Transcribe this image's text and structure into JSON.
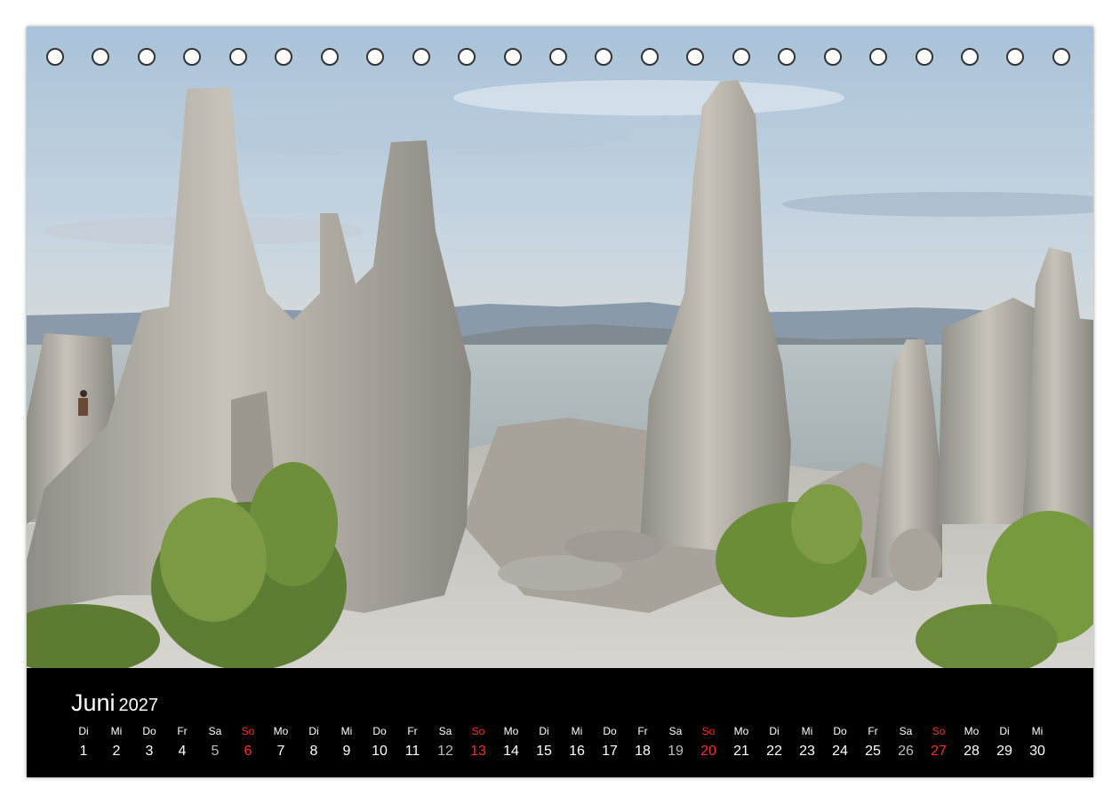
{
  "calendar": {
    "month": "Juni",
    "year": "2027",
    "days": [
      {
        "wd": "Di",
        "d": "1"
      },
      {
        "wd": "Mi",
        "d": "2"
      },
      {
        "wd": "Do",
        "d": "3"
      },
      {
        "wd": "Fr",
        "d": "4"
      },
      {
        "wd": "Sa",
        "d": "5"
      },
      {
        "wd": "So",
        "d": "6"
      },
      {
        "wd": "Mo",
        "d": "7"
      },
      {
        "wd": "Di",
        "d": "8"
      },
      {
        "wd": "Mi",
        "d": "9"
      },
      {
        "wd": "Do",
        "d": "10"
      },
      {
        "wd": "Fr",
        "d": "11"
      },
      {
        "wd": "Sa",
        "d": "12"
      },
      {
        "wd": "So",
        "d": "13"
      },
      {
        "wd": "Mo",
        "d": "14"
      },
      {
        "wd": "Di",
        "d": "15"
      },
      {
        "wd": "Mi",
        "d": "16"
      },
      {
        "wd": "Do",
        "d": "17"
      },
      {
        "wd": "Fr",
        "d": "18"
      },
      {
        "wd": "Sa",
        "d": "19"
      },
      {
        "wd": "So",
        "d": "20"
      },
      {
        "wd": "Mo",
        "d": "21"
      },
      {
        "wd": "Di",
        "d": "22"
      },
      {
        "wd": "Mi",
        "d": "23"
      },
      {
        "wd": "Do",
        "d": "24"
      },
      {
        "wd": "Fr",
        "d": "25"
      },
      {
        "wd": "Sa",
        "d": "26"
      },
      {
        "wd": "So",
        "d": "27"
      },
      {
        "wd": "Mo",
        "d": "28"
      },
      {
        "wd": "Di",
        "d": "29"
      },
      {
        "wd": "Mi",
        "d": "30"
      }
    ]
  },
  "colors": {
    "band": "#000000",
    "weekday_text": "#ffffff",
    "saturday_text": "#bdbdbd",
    "sunday_text": "#ff2a2a"
  }
}
